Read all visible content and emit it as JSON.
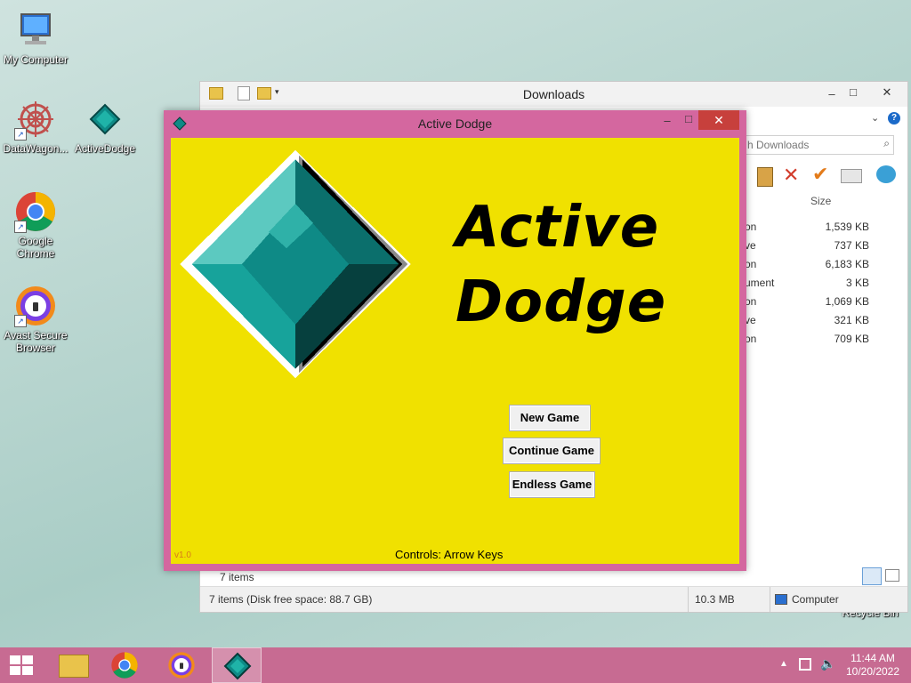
{
  "desktop": {
    "icons": [
      {
        "label": "My Computer"
      },
      {
        "label": "DataWagon..."
      },
      {
        "label": "ActiveDodge"
      },
      {
        "label": "Google Chrome"
      },
      {
        "label": "Avast Secure Browser"
      },
      {
        "label": "Recycle Bin"
      }
    ]
  },
  "explorer": {
    "title": "Downloads",
    "search_placeholder": "h Downloads",
    "column_size": "Size",
    "rows": [
      {
        "type": "on",
        "size": "1,539 KB"
      },
      {
        "type": "ve",
        "size": "737 KB"
      },
      {
        "type": "on",
        "size": "6,183 KB"
      },
      {
        "type": "ument",
        "size": "3 KB"
      },
      {
        "type": "on",
        "size": "1,069 KB"
      },
      {
        "type": "ve",
        "size": "321 KB"
      },
      {
        "type": "on",
        "size": "709 KB"
      }
    ],
    "item_count": "7 items",
    "status_left": "7 items (Disk free space: 88.7 GB)",
    "status_size": "10.3 MB",
    "status_location": "Computer"
  },
  "game": {
    "window_title": "Active Dodge",
    "title_line1": "Active",
    "title_line2": "Dodge",
    "buttons": {
      "new_game": "New Game",
      "continue_game": "Continue Game",
      "endless_game": "Endless Game"
    },
    "controls": "Controls: Arrow Keys",
    "version": "v1.0"
  },
  "taskbar": {
    "time": "11:44 AM",
    "date": "10/20/2022"
  },
  "colors": {
    "game_bg": "#f0e100",
    "window_frame": "#d4679f",
    "taskbar": "#c76b92",
    "gem_teal": "#0e8a86"
  }
}
